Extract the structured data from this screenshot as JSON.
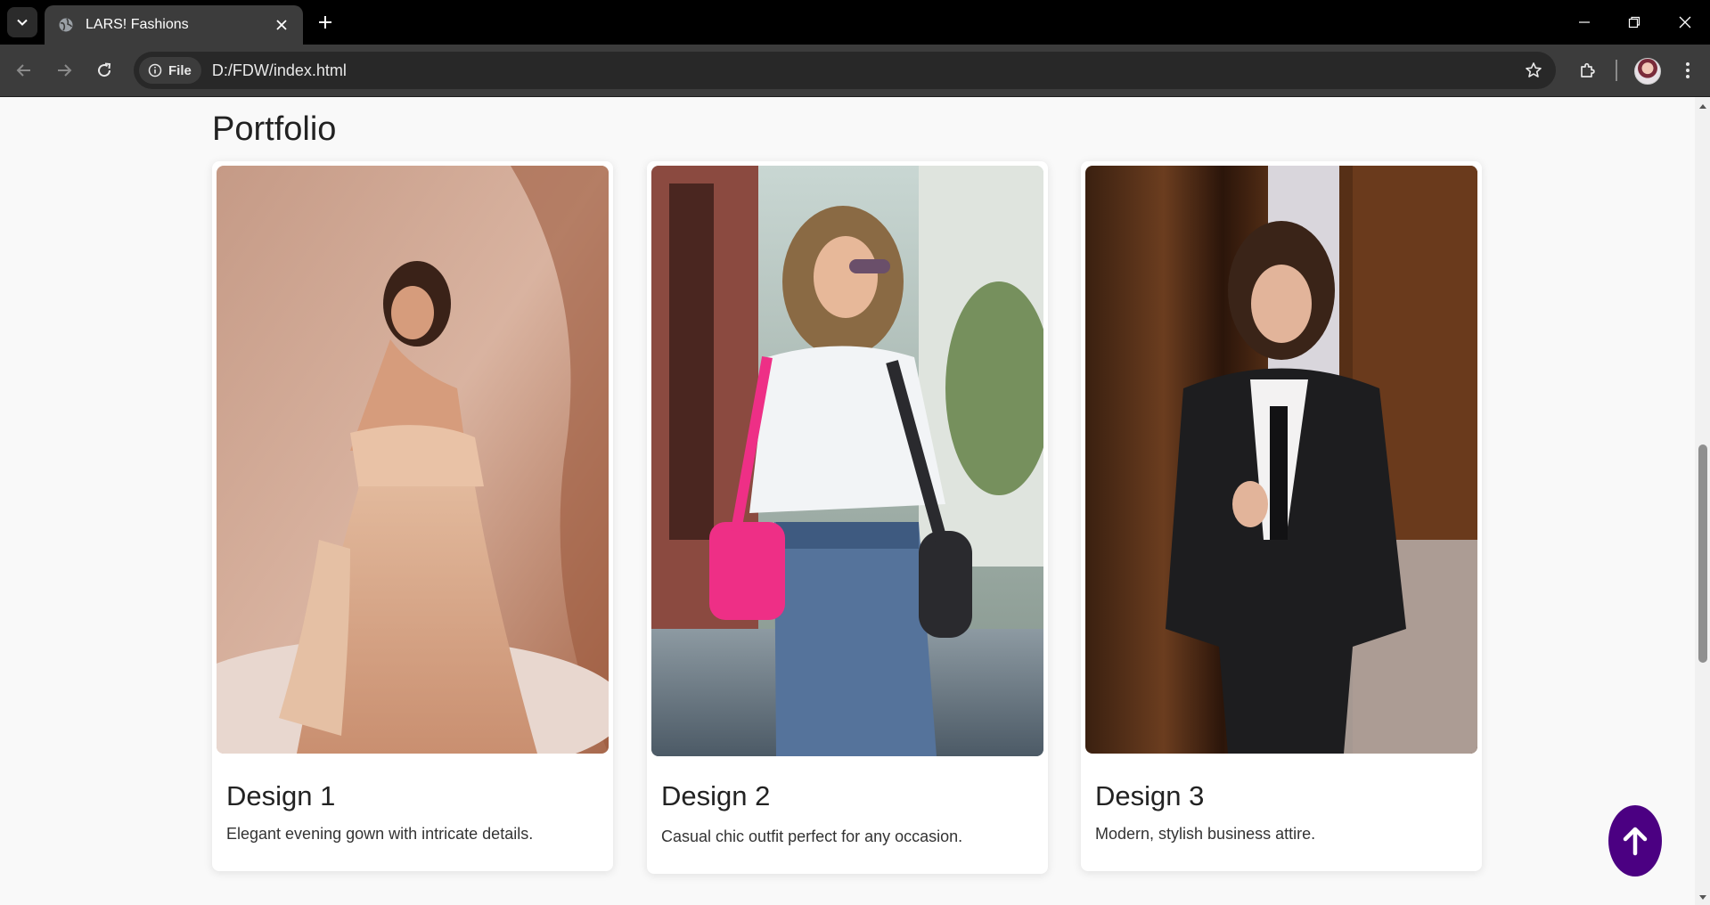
{
  "browser": {
    "tab_title": "LARS! Fashions",
    "site_chip_label": "File",
    "url": "D:/FDW/index.html"
  },
  "page": {
    "section_title": "Portfolio",
    "cards": [
      {
        "title": "Design 1",
        "description": "Elegant evening gown with intricate details."
      },
      {
        "title": "Design 2",
        "description": "Casual chic outfit perfect for any occasion."
      },
      {
        "title": "Design 3",
        "description": "Modern, stylish business attire."
      }
    ]
  },
  "colors": {
    "scroll_top_button": "#4b0082",
    "page_background": "#f9f9f9",
    "browser_frame": "#000000",
    "toolbar": "#3c3c3c"
  },
  "icons": {
    "tab_search": "chevron-down-icon",
    "favicon": "globe-icon",
    "scroll_top": "arrow-up-icon"
  }
}
